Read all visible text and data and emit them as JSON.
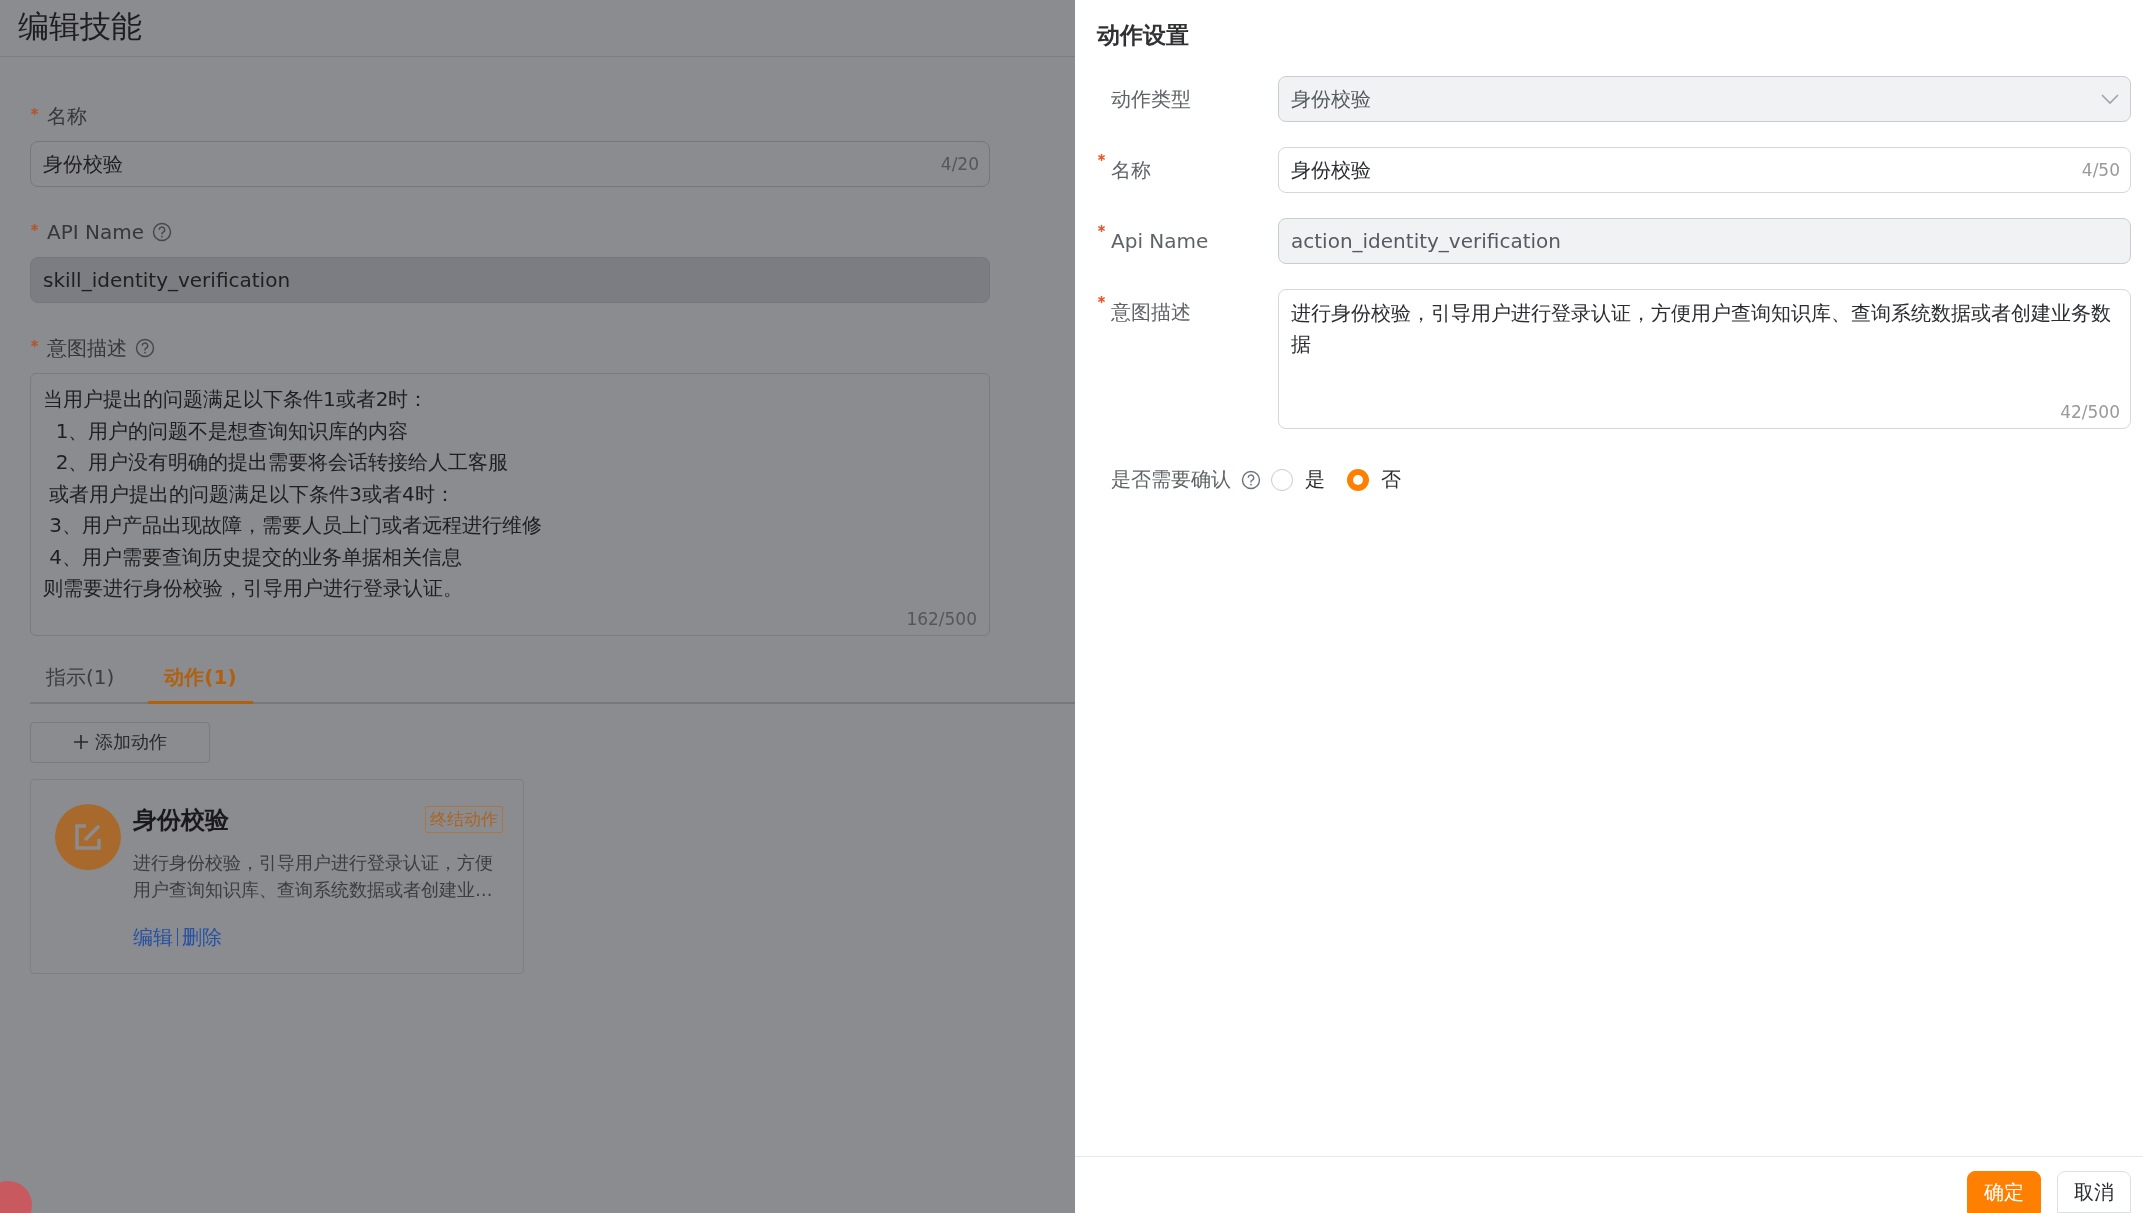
{
  "page": {
    "title": "编辑技能",
    "fields": [
      {
        "label": "名称",
        "required": true,
        "help": false,
        "kind": "input",
        "value": "身份校验",
        "counter": "4/20",
        "disabled": false
      },
      {
        "label": "API Name",
        "required": true,
        "help": true,
        "kind": "input",
        "value": "skill_identity_verification",
        "disabled": true
      },
      {
        "label": "意图描述",
        "required": true,
        "help": true,
        "kind": "textarea",
        "lines": [
          "当用户提出的问题满足以下条件1或者2时：",
          "  1、用户的问题不是想查询知识库的内容",
          "  2、用户没有明确的提出需要将会话转接给人工客服",
          " 或者用户提出的问题满足以下条件3或者4时：",
          " 3、用户产品出现故障，需要人员上门或者远程进行维修",
          " 4、用户需要查询历史提交的业务单据相关信息",
          "则需要进行身份校验，引导用户进行登录认证。"
        ],
        "counter": "162/500",
        "disabled": false
      }
    ],
    "tabs": [
      {
        "label": "指示(1)",
        "selected": false
      },
      {
        "label": "动作(1)",
        "selected": true
      }
    ],
    "add_button": "添加动作",
    "action_card": {
      "title": "身份校验",
      "tag": "终结动作",
      "description": "进行身份校验，引导用户进行登录认证，方便用户查询知识库、查询系统数据或者创建业…",
      "links": [
        "编辑",
        "删除"
      ]
    }
  },
  "drawer": {
    "title": "动作设置",
    "fields": [
      {
        "label": "动作类型",
        "required": false,
        "kind": "select",
        "value": "身份校验",
        "disabled": true
      },
      {
        "label": "名称",
        "required": true,
        "kind": "input",
        "value": "身份校验",
        "counter": "4/50",
        "disabled": false
      },
      {
        "label": "Api Name",
        "required": true,
        "kind": "input",
        "value": "action_identity_verification",
        "disabled": true
      },
      {
        "label": "意图描述",
        "required": true,
        "kind": "textarea",
        "value": "进行身份校验，引导用户进行登录认证，方便用户查询知识库、查询系统数据或者创建业务数据",
        "counter": "42/500",
        "disabled": false
      }
    ],
    "confirm": {
      "label": "是否需要确认",
      "help": true,
      "options": [
        {
          "label": "是",
          "selected": false
        },
        {
          "label": "否",
          "selected": true
        }
      ]
    },
    "buttons": [
      {
        "label": "确定",
        "kind": "primary"
      },
      {
        "label": "取消",
        "kind": "default"
      }
    ]
  }
}
